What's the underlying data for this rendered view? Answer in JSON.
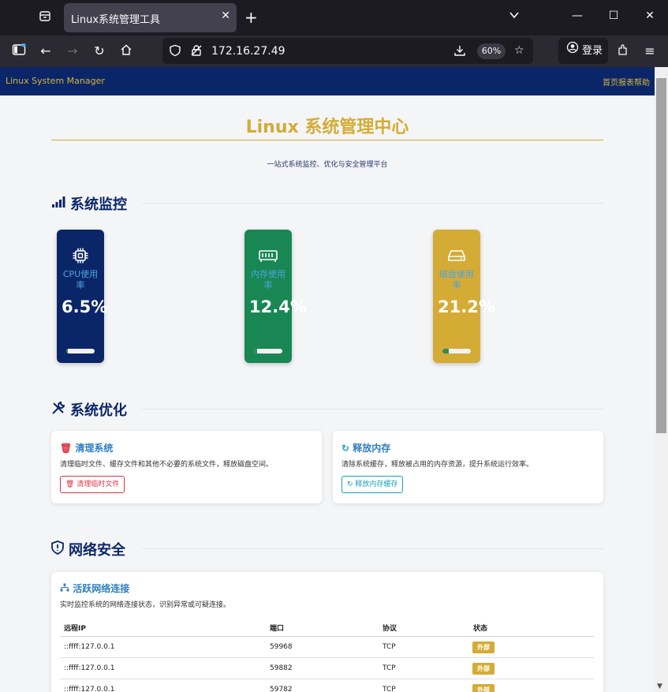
{
  "browser": {
    "tab_title": "Linux系统管理工具",
    "url": "172.16.27.49",
    "zoom": "60%",
    "login_label": "登录"
  },
  "header": {
    "brand": "Linux System Manager",
    "nav": "首页报表帮助"
  },
  "hero": {
    "title": "Linux 系统管理中心",
    "subtitle": "一站式系统监控、优化与安全管理平台"
  },
  "monitor": {
    "title": "系统监控",
    "cards": [
      {
        "label": "CPU使用率",
        "value": "6.5%",
        "percent": 6.5,
        "color": "#0b2668"
      },
      {
        "label": "内存使用率",
        "value": "12.4%",
        "percent": 12.4,
        "color": "#198754"
      },
      {
        "label": "磁盘使用率",
        "value": "21.2%",
        "percent": 21.2,
        "color": "#d4ac35"
      }
    ]
  },
  "optimize": {
    "title": "系统优化",
    "clean": {
      "title": "清理系统",
      "desc": "清理临时文件、缓存文件和其他不必要的系统文件，释放磁盘空间。",
      "button": "清理临时文件"
    },
    "memory": {
      "title": "释放内存",
      "desc": "清除系统缓存，释放被占用的内存资源，提升系统运行效率。",
      "button": "释放内存缓存"
    }
  },
  "security": {
    "title": "网络安全",
    "connections": {
      "title": "活跃网络连接",
      "desc": "实时监控系统的网络连接状态，识别异常或可疑连接。",
      "columns": [
        "远程IP",
        "端口",
        "协议",
        "状态"
      ],
      "rows": [
        {
          "ip": "::ffff:127.0.0.1",
          "port": "59968",
          "protocol": "TCP",
          "status": "外部"
        },
        {
          "ip": "::ffff:127.0.0.1",
          "port": "59882",
          "protocol": "TCP",
          "status": "外部"
        },
        {
          "ip": "::ffff:127.0.0.1",
          "port": "59782",
          "protocol": "TCP",
          "status": "外部"
        }
      ]
    }
  }
}
